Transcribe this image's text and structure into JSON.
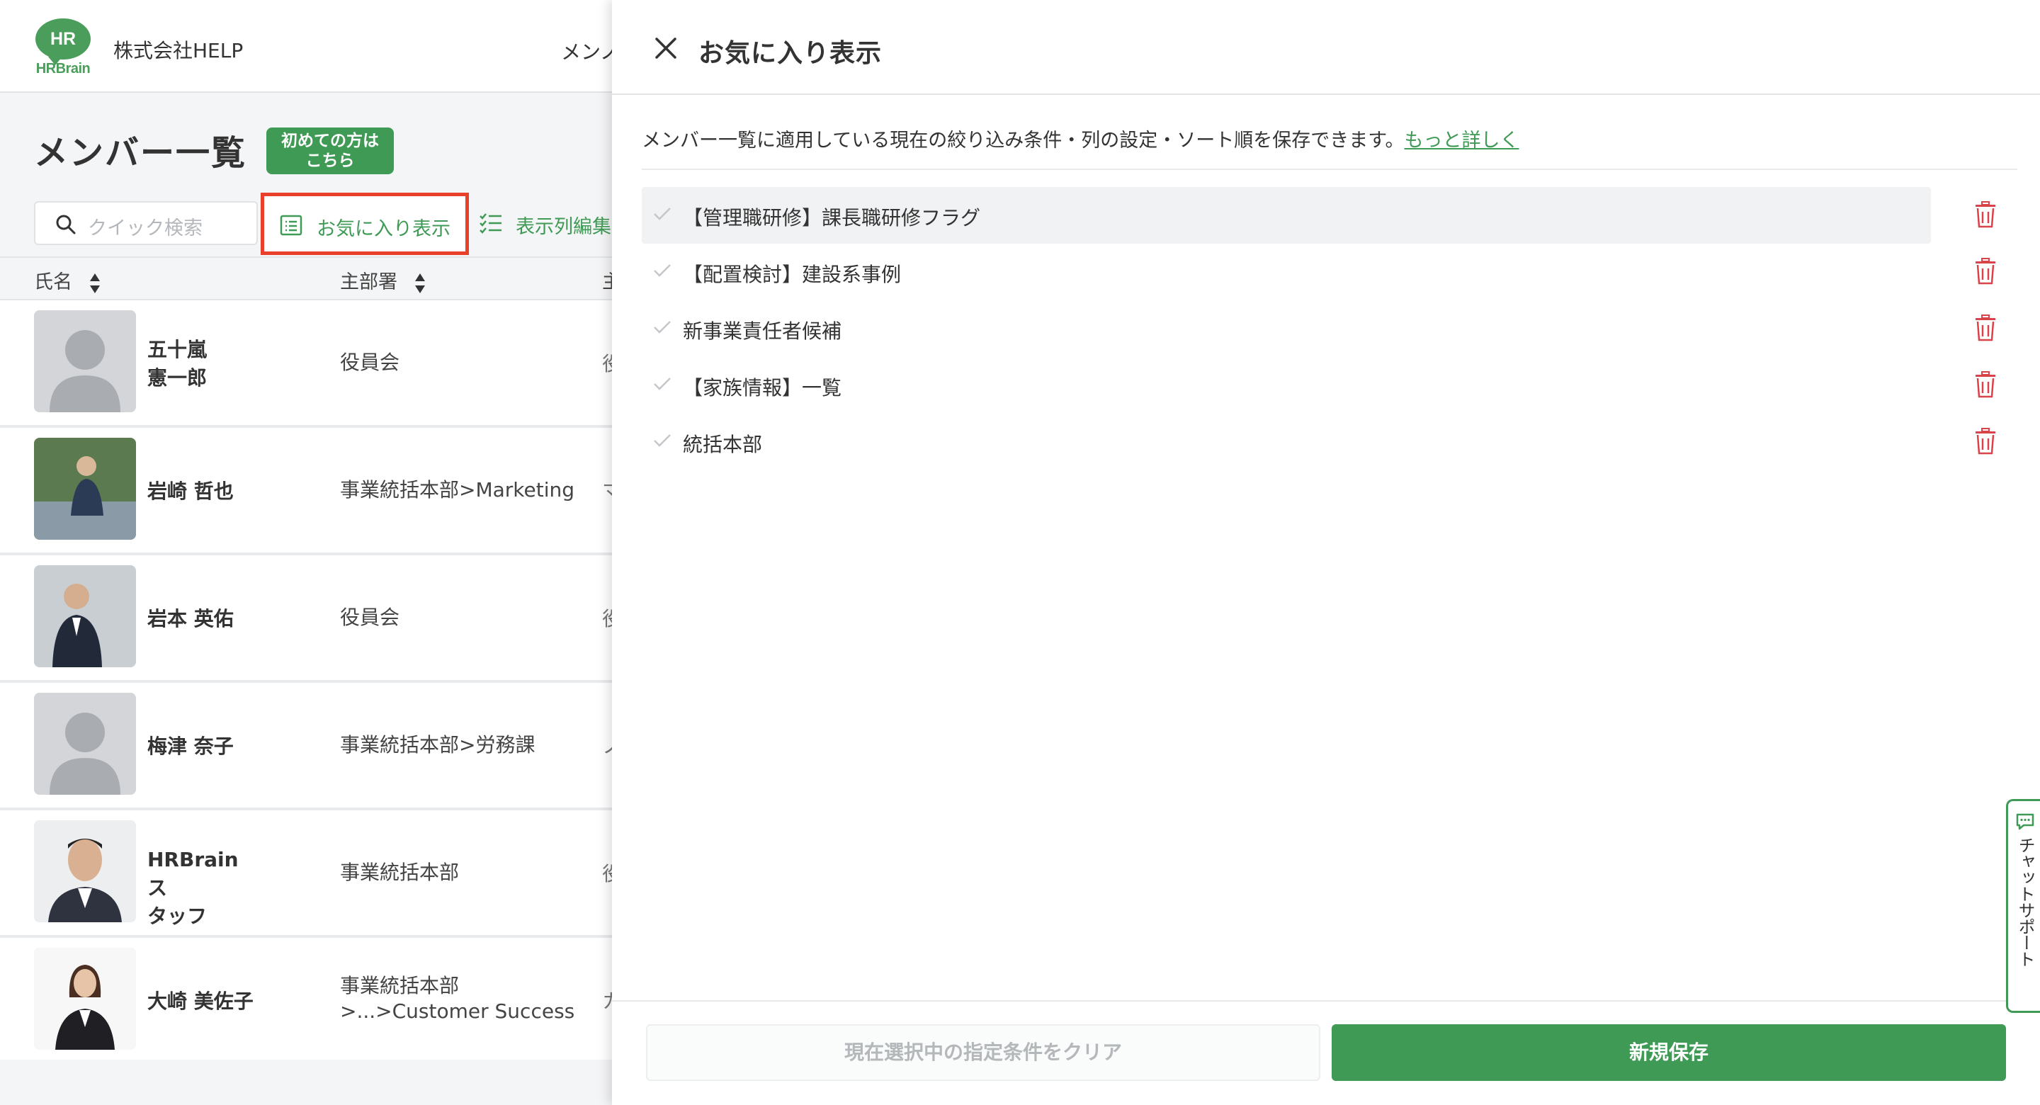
{
  "app": {
    "logo_main": "HR",
    "logo_sub": "HRBrain",
    "company": "株式会社HELP",
    "nav_cut": "メンノ"
  },
  "page": {
    "title": "メンバー一覧",
    "first_time": "初めての方は\nこちら"
  },
  "toolbar": {
    "search_placeholder": "クイック検索",
    "favorites_label": "お気に入り表示",
    "columns_label": "表示列編集"
  },
  "table": {
    "headers": [
      "氏名",
      "主部署",
      "主"
    ],
    "rows": [
      {
        "name": "五十嵐\n憲一郎",
        "dept": "役員会",
        "cut": "役",
        "avatar": "placeholder"
      },
      {
        "name": "岩崎 哲也",
        "dept": "事業統括本部>Marketing",
        "cut": "マ",
        "avatar": "photo"
      },
      {
        "name": "岩本 英佑",
        "dept": "役員会",
        "cut": "役",
        "avatar": "photo"
      },
      {
        "name": "梅津 奈子",
        "dept": "事業統括本部>労務課",
        "cut": "ノ",
        "avatar": "placeholder"
      },
      {
        "name": "HRBrain ス\nタッフ",
        "dept": "事業統括本部",
        "cut": "役",
        "avatar": "photo"
      },
      {
        "name": "大崎 美佐子",
        "dept": "事業統括本部\n>...>Customer Success",
        "cut": "カ",
        "avatar": "photo"
      }
    ]
  },
  "panel": {
    "title": "お気に入り表示",
    "description": "メンバー一覧に適用している現在の絞り込み条件・列の設定・ソート順を保存できます。",
    "more_link": "もっと詳しく",
    "favorites": [
      {
        "label": "【管理職研修】課長職研修フラグ"
      },
      {
        "label": "【配置検討】建設系事例"
      },
      {
        "label": "新事業責任者候補"
      },
      {
        "label": "【家族情報】一覧"
      },
      {
        "label": "統括本部"
      }
    ],
    "clear_button": "現在選択中の指定条件をクリア",
    "save_button": "新規保存"
  },
  "chat": {
    "label": "チャットサポート"
  },
  "colors": {
    "brand_green": "#3f9a55",
    "highlight_red": "#e8402a",
    "trash_red": "#d9434a"
  },
  "icons": [
    "search-icon",
    "list-icon",
    "checklist-icon",
    "sort-icon",
    "close-icon",
    "check-icon",
    "trash-icon",
    "chat-bubble-icon"
  ]
}
